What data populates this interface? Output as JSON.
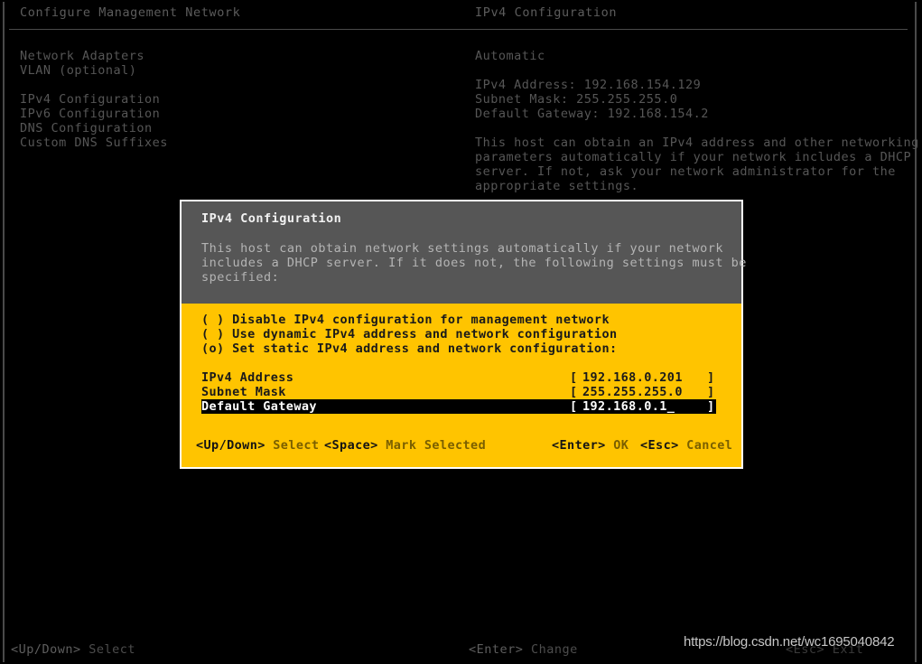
{
  "screen": {
    "title_left": "Configure Management Network",
    "title_right": "IPv4 Configuration"
  },
  "menu": {
    "group_one": [
      {
        "label": "Network Adapters"
      },
      {
        "label": "VLAN (optional)"
      }
    ],
    "group_two": [
      {
        "label": "IPv4 Configuration"
      },
      {
        "label": "IPv6 Configuration"
      },
      {
        "label": "DNS Configuration"
      },
      {
        "label": "Custom DNS Suffixes"
      }
    ]
  },
  "detail": {
    "mode": "Automatic",
    "lines": [
      "IPv4 Address: 192.168.154.129",
      "Subnet Mask: 255.255.255.0",
      "Default Gateway: 192.168.154.2"
    ],
    "paragraph": [
      "This host can obtain an IPv4 address and other networking",
      "parameters automatically if your network includes a DHCP",
      "server. If not, ask your network administrator for the",
      "appropriate settings."
    ]
  },
  "dialog": {
    "title": "IPv4 Configuration",
    "description": [
      "This host can obtain network settings automatically if your network",
      "includes a DHCP server. If it does not, the following settings must be",
      "specified:"
    ],
    "options": [
      {
        "marker": "( )",
        "label": "Disable IPv4 configuration for management network",
        "selected": false
      },
      {
        "marker": "( )",
        "label": "Use dynamic IPv4 address and network configuration",
        "selected": false
      },
      {
        "marker": "(o)",
        "label": "Set static IPv4 address and network configuration:",
        "selected": true
      }
    ],
    "fields": [
      {
        "label": "IPv4 Address",
        "bracket_left": "[",
        "value": "192.168.0.201",
        "bracket_right": "]",
        "highlighted": false
      },
      {
        "label": "Subnet Mask",
        "bracket_left": "[",
        "value": "255.255.255.0",
        "bracket_right": "]",
        "highlighted": false
      },
      {
        "label": "Default Gateway",
        "bracket_left": "[",
        "value": "192.168.0.1_",
        "bracket_right": "]",
        "highlighted": true
      }
    ],
    "footer": {
      "updown_key": "<Up/Down>",
      "updown_label": "Select",
      "space_key": "<Space>",
      "space_label": "Mark Selected",
      "enter_key": "<Enter>",
      "enter_label": "OK",
      "esc_key": "<Esc>",
      "esc_label": "Cancel"
    }
  },
  "status_bar": {
    "updown_key": "<Up/Down>",
    "updown_label": "Select",
    "enter_key": "<Enter>",
    "enter_label": "Change",
    "esc_key": "<Esc>",
    "esc_label": "Exit"
  },
  "watermark": {
    "text": "https://blog.csdn.net/wc1695040842"
  },
  "colors": {
    "background": "#000000",
    "dialog_accent": "#ffc400",
    "dialog_header": "#565656",
    "highlight_bg": "#000000",
    "highlight_fg": "#ffffff",
    "border": "#ffffff",
    "text_dim": "#565656"
  }
}
